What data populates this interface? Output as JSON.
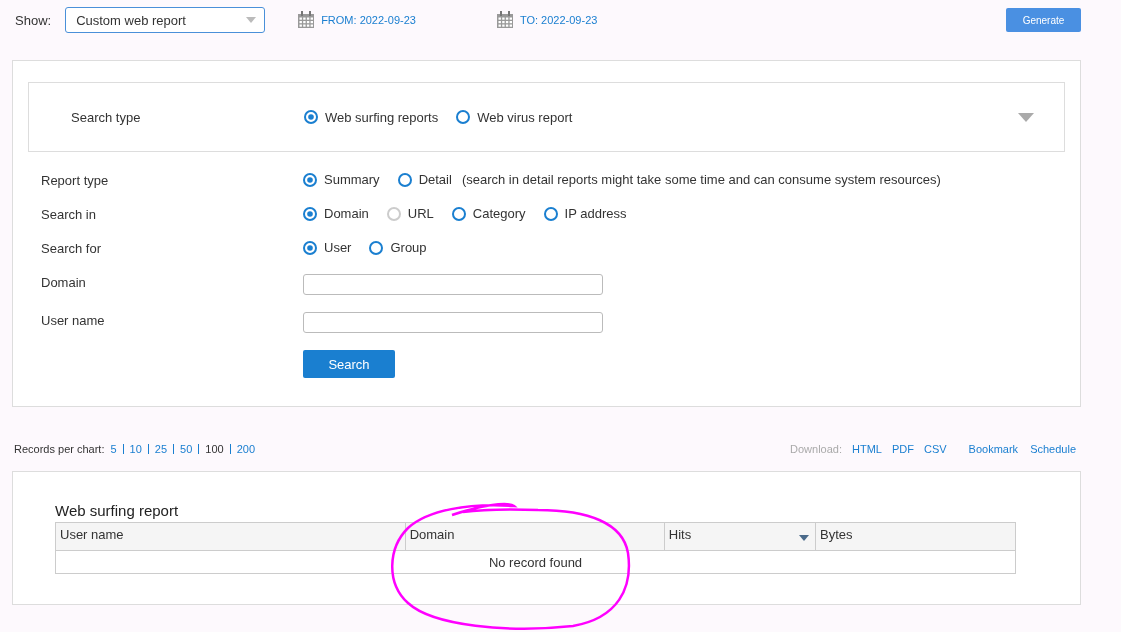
{
  "toolbar": {
    "show_label": "Show:",
    "show_value": "Custom web report",
    "from": "FROM: 2022-09-23",
    "to": "TO: 2022-09-23",
    "generate": "Generate"
  },
  "search_type": {
    "label": "Search type",
    "options": [
      {
        "label": "Web surfing reports",
        "selected": true
      },
      {
        "label": "Web virus report",
        "selected": false
      }
    ]
  },
  "form_rows": [
    {
      "kind": "radio",
      "label": "Report type",
      "options": [
        {
          "label": "Summary",
          "selected": true,
          "disabled": false
        },
        {
          "label": "Detail",
          "selected": false,
          "disabled": false
        }
      ],
      "note": "(search in detail reports might take some time and can consume system resources)"
    },
    {
      "kind": "radio",
      "label": "Search in",
      "options": [
        {
          "label": "Domain",
          "selected": true,
          "disabled": false
        },
        {
          "label": "URL",
          "selected": false,
          "disabled": true
        },
        {
          "label": "Category",
          "selected": false,
          "disabled": false
        },
        {
          "label": "IP address",
          "selected": false,
          "disabled": false
        }
      ]
    },
    {
      "kind": "radio",
      "label": "Search for",
      "options": [
        {
          "label": "User",
          "selected": true,
          "disabled": false
        },
        {
          "label": "Group",
          "selected": false,
          "disabled": false
        }
      ]
    },
    {
      "kind": "input",
      "label": "Domain"
    },
    {
      "kind": "input",
      "label": "User name"
    }
  ],
  "search_button": "Search",
  "records": {
    "label": "Records per chart:",
    "options": [
      {
        "label": "5",
        "selected": false
      },
      {
        "label": "10",
        "selected": false
      },
      {
        "label": "25",
        "selected": false
      },
      {
        "label": "50",
        "selected": false
      },
      {
        "label": "100",
        "selected": true
      },
      {
        "label": "200",
        "selected": false
      }
    ]
  },
  "download": {
    "label": "Download:",
    "formats": [
      "HTML",
      "PDF",
      "CSV"
    ],
    "actions": [
      "Bookmark",
      "Schedule"
    ]
  },
  "report": {
    "title": "Web surfing report",
    "columns": [
      {
        "label": "User name",
        "sorted": false
      },
      {
        "label": "Domain",
        "sorted": false
      },
      {
        "label": "Hits",
        "sorted": true
      },
      {
        "label": "Bytes",
        "sorted": false
      }
    ],
    "empty_message": "No record found"
  }
}
